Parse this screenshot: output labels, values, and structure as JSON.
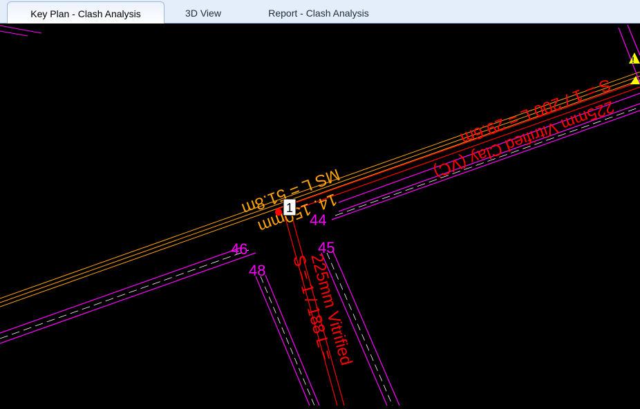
{
  "tabs": [
    {
      "label": "Key Plan - Clash Analysis",
      "active": true
    },
    {
      "label": "3D View",
      "active": false
    },
    {
      "label": "Report - Clash Analysis",
      "active": false
    }
  ],
  "drawing": {
    "pipe_labels": {
      "ms_length": "MS  L = 51.8m",
      "ms_size": "14.  150mm",
      "slope_main": "S = 1 / 200  L = 29.6m",
      "pipe_main": "225mm  Vitrified Clay (VC)",
      "slope_branch": "S = 1 / 188  L =",
      "pipe_branch": "225mm  Vitrified"
    },
    "node_labels": {
      "n44": "44",
      "n45": "45",
      "n46": "46",
      "n48": "48"
    },
    "clash_marker": "1",
    "warning_symbol": "!",
    "colors": {
      "background": "#000000",
      "magenta": "#ff00ff",
      "orange": "#ffa500",
      "red": "#ff0000",
      "yellow": "#ffff00",
      "white": "#ffffff"
    }
  }
}
